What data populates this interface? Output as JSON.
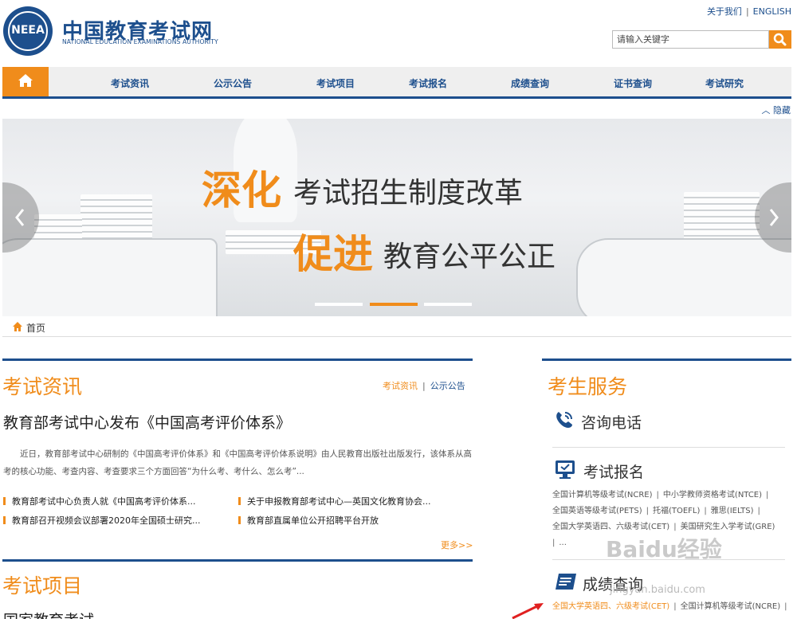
{
  "header": {
    "logo_text": "NEEA",
    "title": "中国教育考试网",
    "subtitle": "NATIONAL EDUCATION EXAMINATIONS AUTHORITY",
    "links": [
      "关于我们",
      "ENGLISH"
    ],
    "search_placeholder": "请输入关键字"
  },
  "nav": {
    "items": [
      "考试资讯",
      "公示公告",
      "考试项目",
      "考试报名",
      "成绩查询",
      "证书查询",
      "考试研究"
    ],
    "collapse_label": "隐藏"
  },
  "banner": {
    "line1_highlight": "深化",
    "line1_rest": "考试招生制度改革",
    "line2_highlight": "促进",
    "line2_rest": "教育公平公正",
    "active_slide": 2,
    "slide_count": 3
  },
  "breadcrumb": {
    "label": "首页"
  },
  "news": {
    "title": "考试资讯",
    "tabs": [
      "考试资讯",
      "公示公告"
    ],
    "headline": "教育部考试中心发布《中国高考评价体系》",
    "summary": "近日，教育部考试中心研制的《中国高考评价体系》和《中国高考评价体系说明》由人民教育出版社出版发行，该体系从高考的核心功能、考查内容、考查要求三个方面回答“为什么考、考什么、怎么考”...",
    "items": [
      "教育部考试中心负责人就《中国高考评价体系...",
      "关于申报教育部考试中心—英国文化教育协会...",
      "教育部召开视频会议部署2020年全国硕士研究...",
      "教育部直属单位公开招聘平台开放"
    ],
    "more": "更多>>"
  },
  "exam_projects": {
    "title": "考试项目",
    "subtitle": "国家教育考试"
  },
  "services": {
    "title": "考生服务",
    "hotline": "咨询电话",
    "register": {
      "title": "考试报名",
      "links": [
        "全国计算机等级考试(NCRE)",
        "中小学教师资格考试(NTCE)",
        "全国英语等级考试(PETS)",
        "托福(TOEFL)",
        "雅思(IELTS)",
        "全国大学英语四、六级考试(CET)",
        "美国研究生入学考试(GRE)",
        "..."
      ]
    },
    "scores": {
      "title": "成绩查询",
      "links": [
        "全国大学英语四、六级考试(CET)",
        "全国计算机等级考试(NCRE)"
      ]
    }
  },
  "watermark": {
    "brand": "Baidu经验",
    "url": "jingyan.baidu.com"
  },
  "colors": {
    "brand_blue": "#1d4f8d",
    "accent_orange": "#f08c1b"
  }
}
